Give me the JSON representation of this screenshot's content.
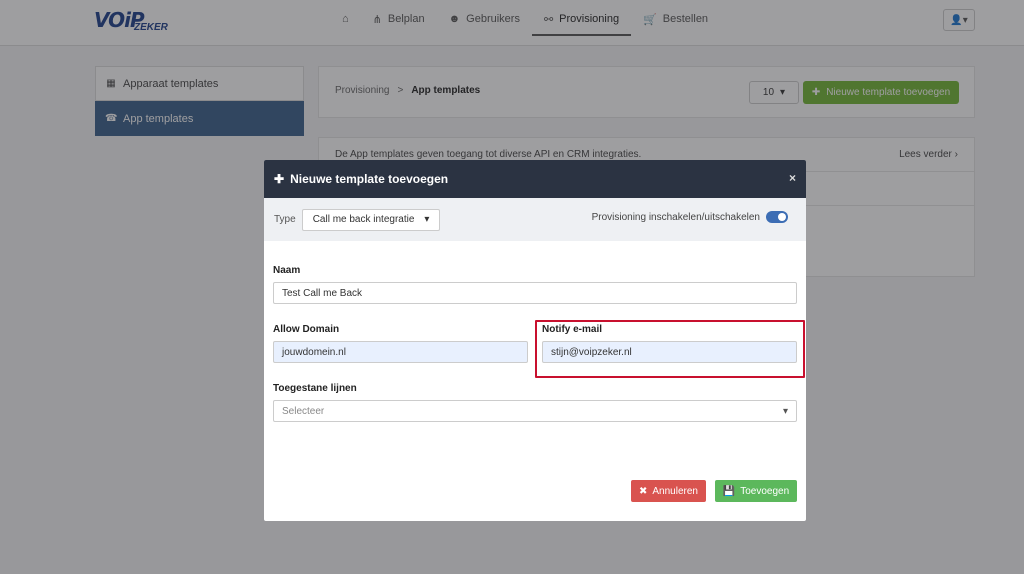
{
  "logo": {
    "main": "VOiP",
    "sub": "ZEKER"
  },
  "nav": {
    "items": [
      {
        "label": "",
        "icon": "home-icon"
      },
      {
        "label": "Belplan",
        "icon": "sitemap-icon"
      },
      {
        "label": "Gebruikers",
        "icon": "users-icon"
      },
      {
        "label": "Provisioning",
        "icon": "network-icon"
      },
      {
        "label": "Bestellen",
        "icon": "cart-icon"
      }
    ],
    "active": "Provisioning"
  },
  "sidebar": {
    "items": [
      {
        "label": "Apparaat templates",
        "icon": "device-icon"
      },
      {
        "label": "App templates",
        "icon": "phone-square-icon"
      }
    ]
  },
  "breadcrumb": {
    "parent": "Provisioning",
    "separator": ">",
    "current": "App templates"
  },
  "toolbar": {
    "page_size": "10",
    "add_label": "Nieuwe template toevoegen"
  },
  "info": {
    "text": "De App templates geven toegang tot diverse API en CRM integraties.",
    "more": "Lees verder"
  },
  "modal": {
    "title": "Nieuwe template toevoegen",
    "type_label": "Type",
    "type_value": "Call me back integratie",
    "toggle_label": "Provisioning inschakelen/uitschakelen",
    "toggle_on": true,
    "naam_label": "Naam",
    "naam_value": "Test Call me Back",
    "allow_label": "Allow Domain",
    "allow_value": "jouwdomein.nl",
    "notify_label": "Notify e-mail",
    "notify_value": "stijn@voipzeker.nl",
    "lijnen_label": "Toegestane lijnen",
    "lijnen_placeholder": "Selecteer",
    "cancel_label": "Annuleren",
    "submit_label": "Toevoegen"
  },
  "colors": {
    "accent_green": "#72b634",
    "sidebar_active": "#3a5f8a",
    "modal_header": "#2b3342",
    "highlight_red": "#c8102e",
    "cancel_red": "#d9534f",
    "submit_green": "#5cb85c"
  }
}
